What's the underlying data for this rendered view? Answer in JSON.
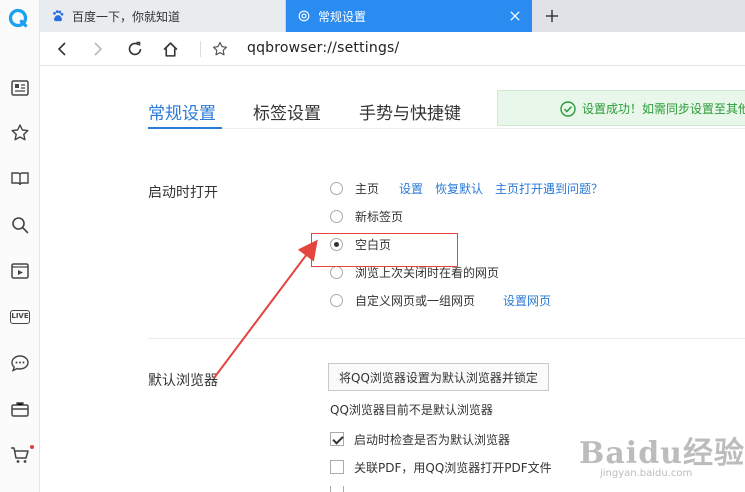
{
  "tabs": [
    {
      "label": "百度一下，你就知道",
      "icon": "baidu-paw-icon"
    },
    {
      "label": "常规设置",
      "icon": "settings-gear-icon",
      "active": true
    }
  ],
  "address": {
    "url": "qqbrowser://settings/"
  },
  "settings_tabs": [
    {
      "label": "常规设置",
      "active": true
    },
    {
      "label": "标签设置"
    },
    {
      "label": "手势与快捷键"
    }
  ],
  "toast": {
    "message": "设置成功！如需同步设置至其他"
  },
  "startup": {
    "label": "启动时打开",
    "options": [
      {
        "label": "主页",
        "selected": false
      },
      {
        "label": "新标签页",
        "selected": false
      },
      {
        "label": "空白页",
        "selected": true
      },
      {
        "label": "浏览上次关闭时在看的网页",
        "selected": false
      },
      {
        "label": "自定义网页或一组网页",
        "selected": false
      }
    ],
    "home_links": [
      "设置",
      "恢复默认",
      "主页打开遇到问题？"
    ],
    "custom_link": "设置网页"
  },
  "default_browser": {
    "label": "默认浏览器",
    "button": "将QQ浏览器设置为默认浏览器并锁定",
    "note": "QQ浏览器目前不是默认浏览器",
    "checks": [
      {
        "label": "启动时检查是否为默认浏览器",
        "checked": true
      },
      {
        "label": "关联PDF，用QQ浏览器打开PDF文件",
        "checked": false
      }
    ]
  },
  "watermark": {
    "text": "Baidu经验",
    "sub": "jingyan.baidu.com"
  },
  "colors": {
    "accent": "#2a7ad8",
    "tab_active": "#2a8cf0",
    "annotation": "#e2463c",
    "success": "#2c9b3a"
  }
}
